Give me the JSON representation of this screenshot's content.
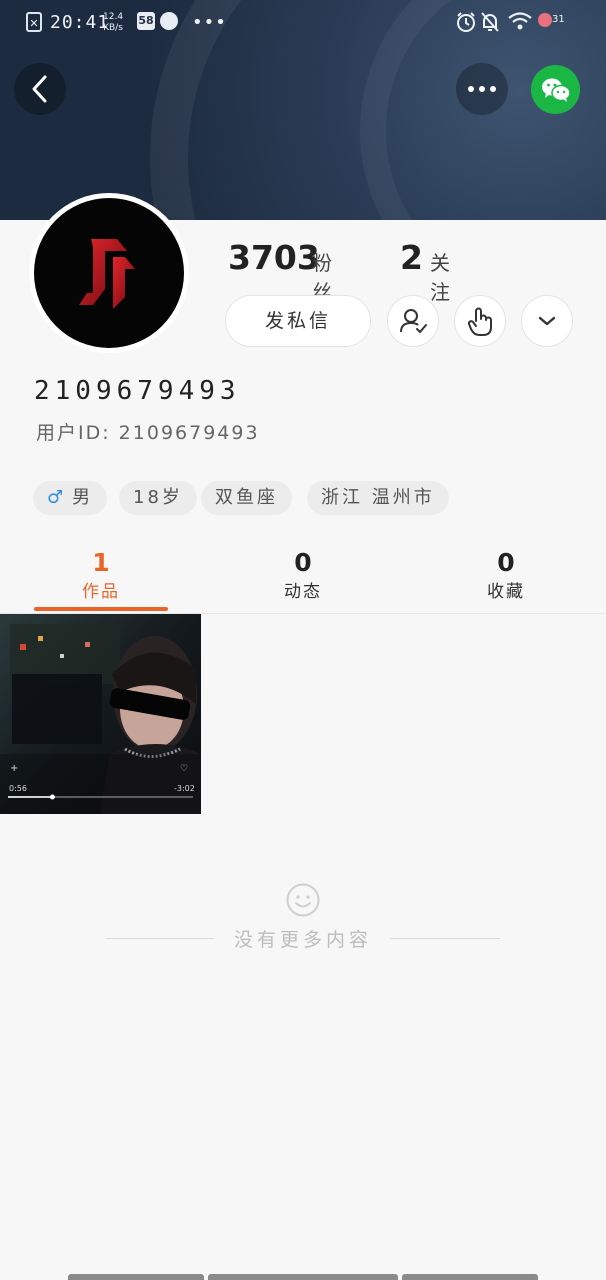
{
  "status_bar": {
    "time": "20:41",
    "net_speed": "12.4",
    "net_unit": "KB/s",
    "app_badge": "58",
    "battery": "31"
  },
  "header": {
    "back_icon": "chevron-left-icon",
    "more_icon": "more-horizontal-icon",
    "share_icon": "wechat-icon",
    "accent": "#1bb745"
  },
  "profile": {
    "fans_count": "3703",
    "fans_label": "粉丝",
    "follow_count": "2",
    "follow_label": "关注",
    "message_button": "发私信",
    "username": "2109679493",
    "user_id_label": "用户ID: 2109679493",
    "tags": {
      "gender_symbol": "♂",
      "gender": "男",
      "age": "18岁",
      "constellation": "双鱼座",
      "location": "浙江 温州市"
    }
  },
  "tabs": [
    {
      "count": "1",
      "label": "作品"
    },
    {
      "count": "0",
      "label": "动态"
    },
    {
      "count": "0",
      "label": "收藏"
    }
  ],
  "accent_color": "#e8652a",
  "video_thumb": {
    "time_current": "0:56",
    "time_remaining": "-3:02",
    "progress": 0.24
  },
  "empty_state": {
    "text": "没有更多内容"
  }
}
